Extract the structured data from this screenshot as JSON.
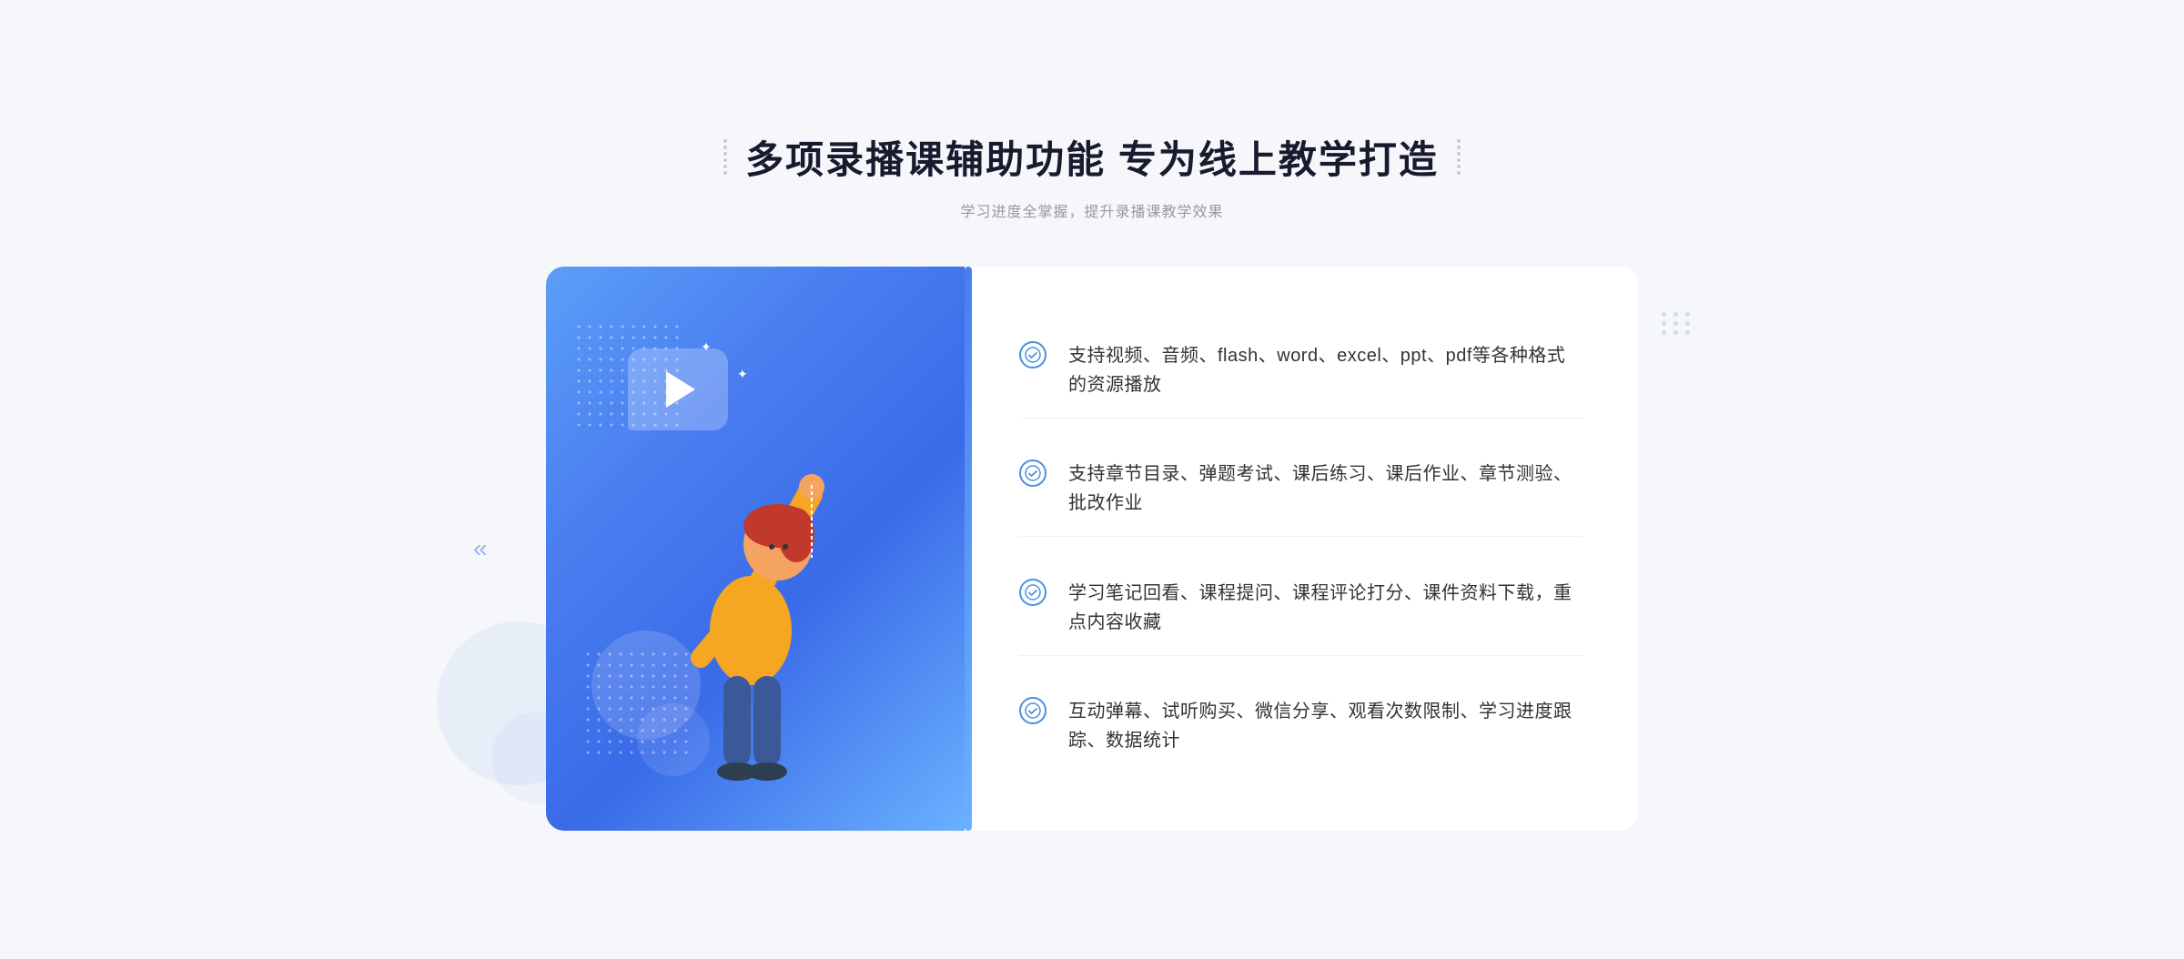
{
  "header": {
    "title": "多项录播课辅助功能 专为线上教学打造",
    "subtitle": "学习进度全掌握，提升录播课教学效果"
  },
  "features": [
    {
      "id": "feature-1",
      "text": "支持视频、音频、flash、word、excel、ppt、pdf等各种格式的资源播放"
    },
    {
      "id": "feature-2",
      "text": "支持章节目录、弹题考试、课后练习、课后作业、章节测验、批改作业"
    },
    {
      "id": "feature-3",
      "text": "学习笔记回看、课程提问、课程评论打分、课件资料下载，重点内容收藏"
    },
    {
      "id": "feature-4",
      "text": "互动弹幕、试听购买、微信分享、观看次数限制、学习进度跟踪、数据统计"
    }
  ],
  "colors": {
    "primary": "#4a7ef0",
    "secondary": "#6ab0ff",
    "text_dark": "#1a1a2e",
    "text_light": "#999999",
    "text_body": "#333333"
  },
  "icons": {
    "check": "✓",
    "play": "▶",
    "left_arrows": "«",
    "right_arrows": "»"
  }
}
